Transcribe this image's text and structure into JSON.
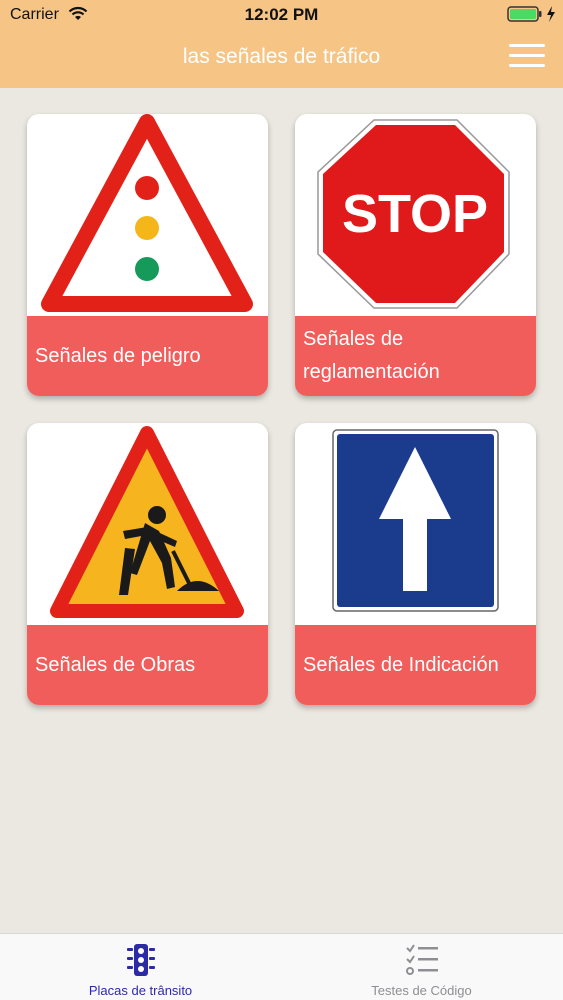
{
  "status_bar": {
    "carrier": "Carrier",
    "time": "12:02 PM"
  },
  "header": {
    "title": "las señales de tráfico",
    "background": "#f6c586"
  },
  "stop_sign_text": "STOP",
  "cards": [
    {
      "label": "Señales de peligro",
      "icon": "traffic-light-warning-sign"
    },
    {
      "label": "Señales de reglamentación",
      "icon": "stop-sign"
    },
    {
      "label": "Señales de Obras",
      "icon": "road-works-sign"
    },
    {
      "label": "Señales de Indicación",
      "icon": "one-way-arrow-sign"
    }
  ],
  "tab_bar": {
    "tabs": [
      {
        "label": "Placas de trânsito",
        "icon": "traffic-light-icon",
        "active": true,
        "color": "#2d2aa6"
      },
      {
        "label": "Testes de Código",
        "icon": "checklist-icon",
        "active": false,
        "color": "#8e8e93"
      }
    ]
  },
  "colors": {
    "card_label_bg": "#f05d5b",
    "page_bg": "#ebe7e1"
  }
}
